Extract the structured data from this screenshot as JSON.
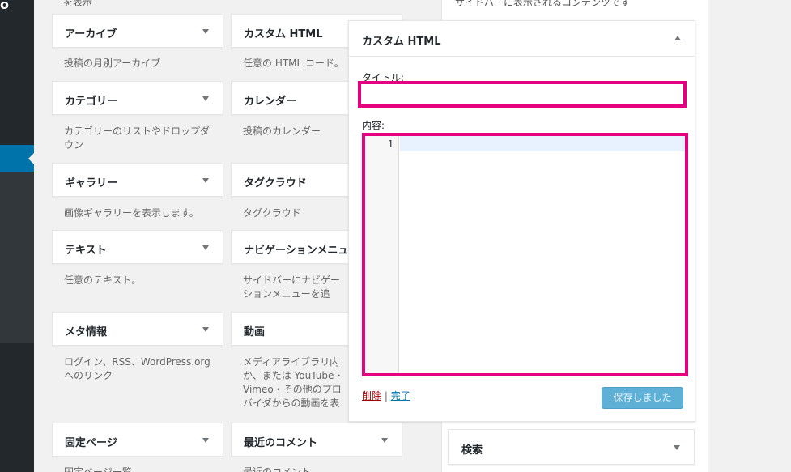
{
  "available_widgets": {
    "top_desc_left": "を表示",
    "left": [
      {
        "title": "アーカイブ",
        "desc": "投稿の月別アーカイブ"
      },
      {
        "title": "カテゴリー",
        "desc": "カテゴリーのリストやドロップダウン"
      },
      {
        "title": "ギャラリー",
        "desc": "画像ギャラリーを表示します。"
      },
      {
        "title": "テキスト",
        "desc": "任意のテキスト。"
      },
      {
        "title": "メタ情報",
        "desc": "ログイン、RSS、WordPress.org へのリンク"
      },
      {
        "title": "固定ページ",
        "desc": "固定ページ一覧"
      }
    ],
    "right": [
      {
        "title": "カスタム HTML",
        "desc": "任意の HTML コード。"
      },
      {
        "title": "カレンダー",
        "desc": "投稿のカレンダー"
      },
      {
        "title": "タグクラウド",
        "desc": "タグクラウド"
      },
      {
        "title": "ナビゲーションメニュー",
        "desc": "サイドバーにナビゲーションメニューを追加。"
      },
      {
        "title": "動画",
        "desc": "メディアライブラリ内か、または YouTube・Vimeo・その他のプロバイダからの動画を表示"
      },
      {
        "title": "最近のコメント",
        "desc": "最近のコメント"
      }
    ]
  },
  "sidebar": {
    "description": "サイドバーに表示されるコンテンツです",
    "edit_widget": {
      "title": "カスタム HTML",
      "title_label": "タイトル:",
      "title_value": "",
      "content_label": "内容:",
      "line_number": "1",
      "delete_link": "削除",
      "separator": "|",
      "done_link": "完了",
      "save_button": "保存しました"
    },
    "search_widget": {
      "title": "検索"
    }
  },
  "colors": {
    "highlight": "#e5007f",
    "admin_menu": "#23282d",
    "active_menu": "#0073aa",
    "save_button": "#5fb0d6"
  }
}
